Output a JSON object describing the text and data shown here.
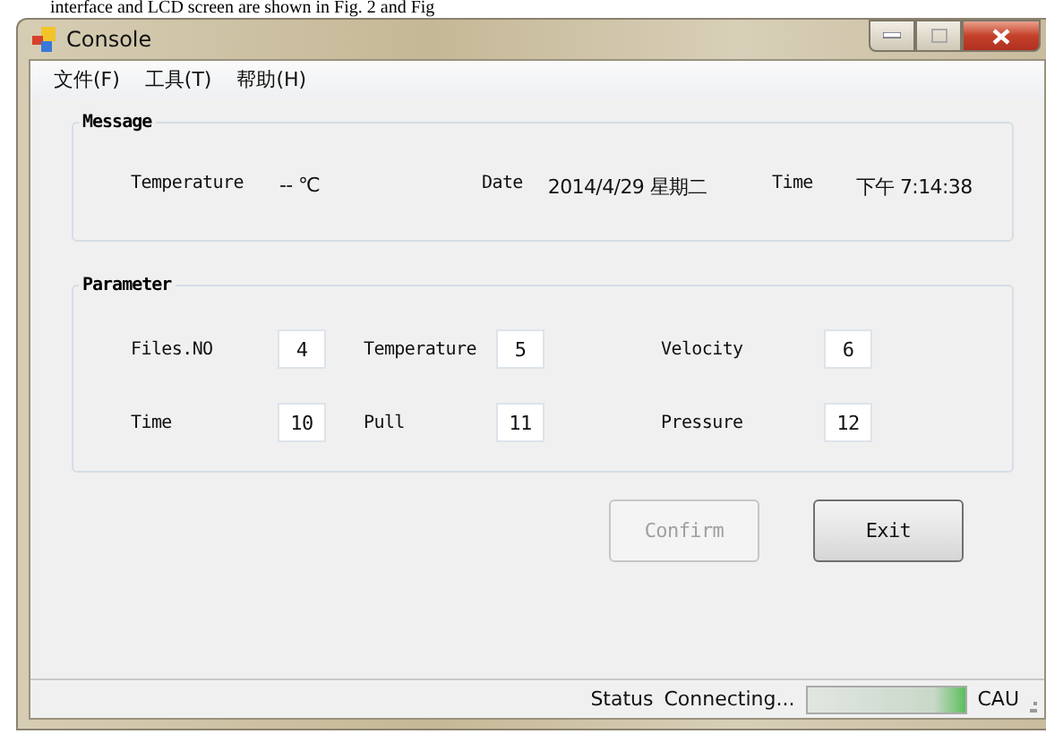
{
  "caption": "interface and LCD screen are shown in Fig. 2 and Fig",
  "window": {
    "title": "Console"
  },
  "menu": [
    "文件(F)",
    "工具(T)",
    "帮助(H)"
  ],
  "message": {
    "title": "Message",
    "items": [
      {
        "label": "Temperature",
        "value": "-- ℃"
      },
      {
        "label": "Date",
        "value": "2014/4/29 星期二"
      },
      {
        "label": "Time",
        "value": "下午 7:14:38"
      }
    ]
  },
  "parameter": {
    "title": "Parameter",
    "fields": [
      {
        "label": "Files.NO",
        "value": "4"
      },
      {
        "label": "Temperature",
        "value": "5"
      },
      {
        "label": "Velocity",
        "value": "6"
      },
      {
        "label": "Time",
        "value": "10"
      },
      {
        "label": "Pull",
        "value": "11"
      },
      {
        "label": "Pressure",
        "value": "12"
      }
    ]
  },
  "buttons": [
    {
      "label": "Confirm",
      "disabled": true
    },
    {
      "label": "Exit",
      "disabled": false
    }
  ],
  "status_bar": {
    "label": "Status",
    "text": "Connecting...",
    "progress": {
      "level": 1
    },
    "end_text": "CAU"
  }
}
